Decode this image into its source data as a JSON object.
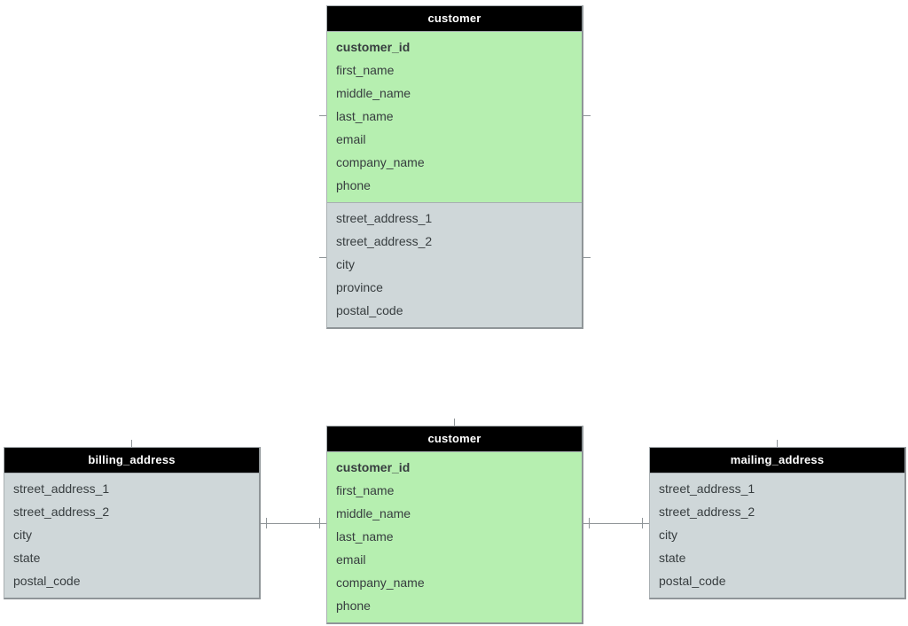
{
  "entities": {
    "customer_top": {
      "title": "customer",
      "green": [
        "customer_id",
        "first_name",
        "middle_name",
        "last_name",
        "email",
        "company_name",
        "phone"
      ],
      "grey": [
        "street_address_1",
        "street_address_2",
        "city",
        "province",
        "postal_code"
      ]
    },
    "billing_address": {
      "title": "billing_address",
      "grey": [
        "street_address_1",
        "street_address_2",
        "city",
        "state",
        "postal_code"
      ]
    },
    "customer_bottom": {
      "title": "customer",
      "green": [
        "customer_id",
        "first_name",
        "middle_name",
        "last_name",
        "email",
        "company_name",
        "phone"
      ]
    },
    "mailing_address": {
      "title": "mailing_address",
      "grey": [
        "street_address_1",
        "street_address_2",
        "city",
        "state",
        "postal_code"
      ]
    }
  }
}
